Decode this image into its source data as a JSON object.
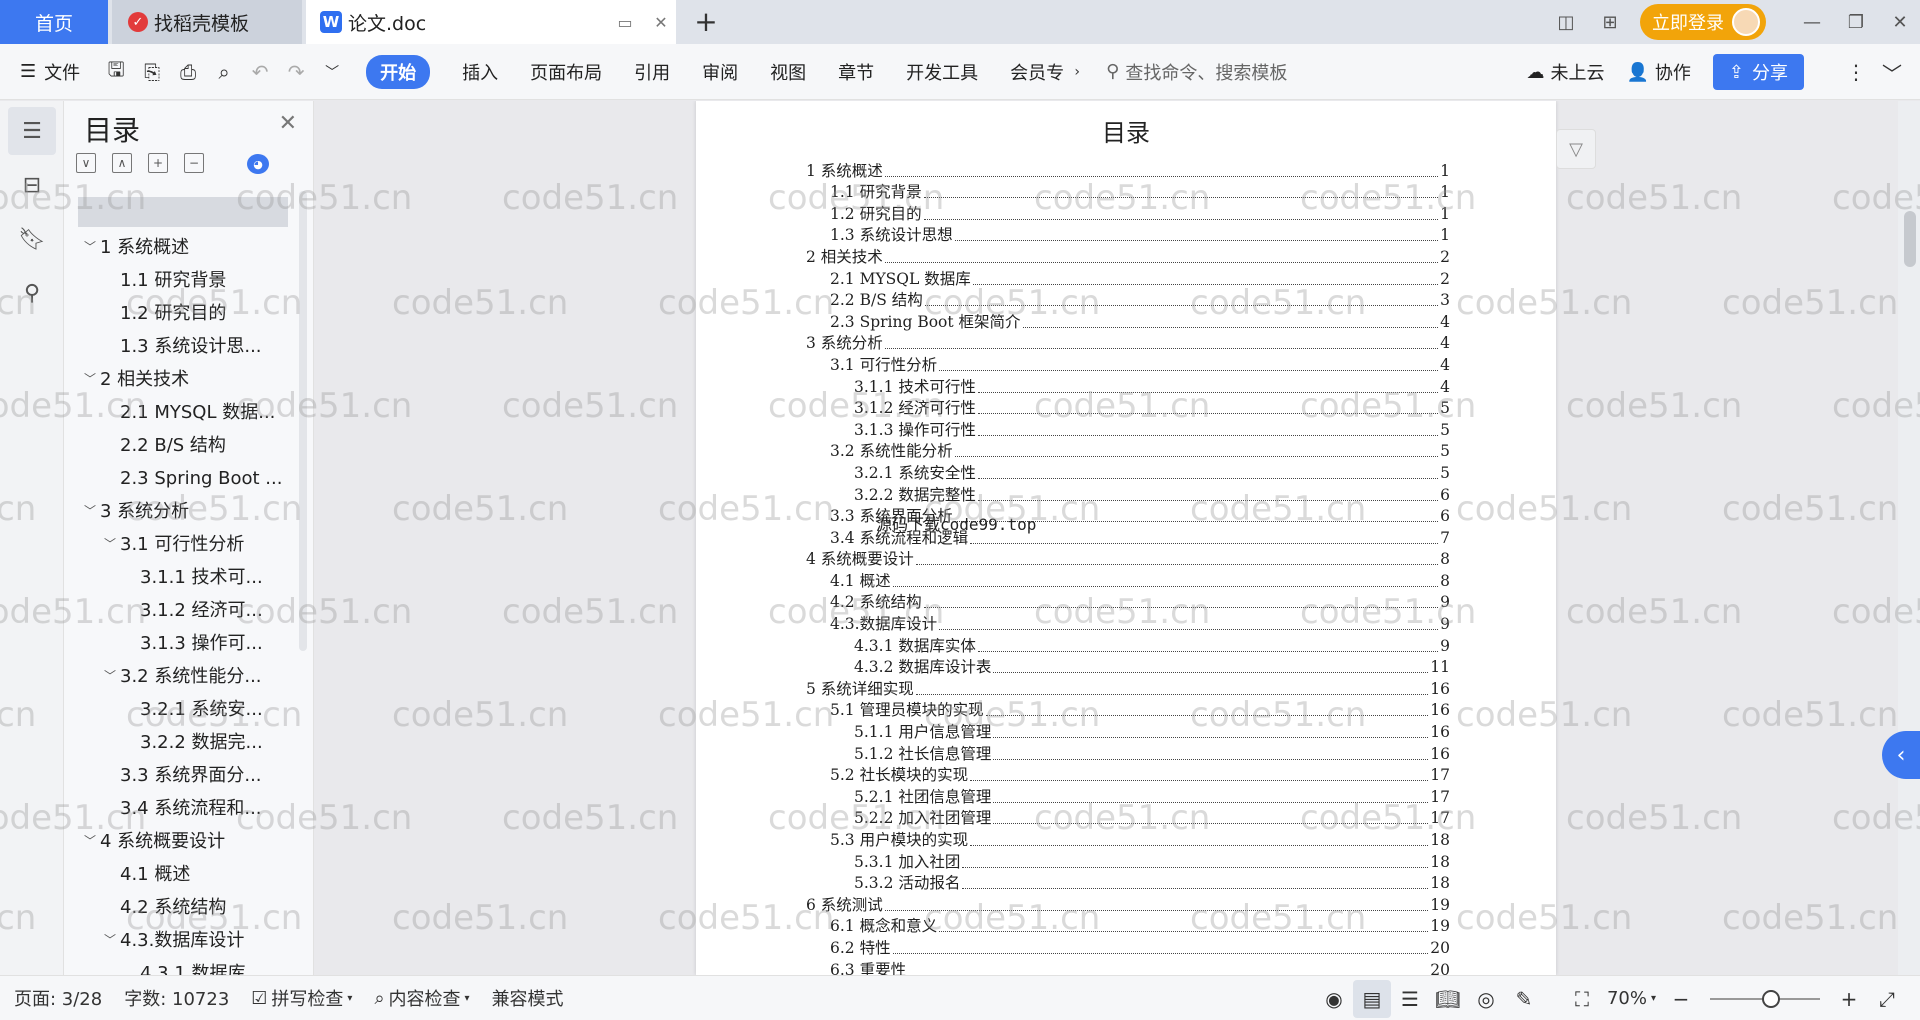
{
  "titlebar": {
    "tab_home": "首页",
    "tab_daoke": "找稻壳模板",
    "tab_doc": "论文.doc",
    "login": "立即登录"
  },
  "toolbar": {
    "file": "文件",
    "tabs": [
      "开始",
      "插入",
      "页面布局",
      "引用",
      "审阅",
      "视图",
      "章节",
      "开发工具",
      "会员专"
    ],
    "search_placeholder": "查找命令、搜索模板",
    "cloud": "未上云",
    "collab": "协作",
    "share": "分享"
  },
  "toc_panel": {
    "title": "目录",
    "items": [
      {
        "label": "1 系统概述",
        "level": 0,
        "caret": "﹀"
      },
      {
        "label": "1.1  研究背景",
        "level": 1,
        "caret": ""
      },
      {
        "label": "1.2 研究目的",
        "level": 1,
        "caret": ""
      },
      {
        "label": "1.3 系统设计思...",
        "level": 1,
        "caret": ""
      },
      {
        "label": "2 相关技术",
        "level": 0,
        "caret": "﹀"
      },
      {
        "label": "2.1 MYSQL 数据...",
        "level": 1,
        "caret": ""
      },
      {
        "label": "2.2 B/S 结构",
        "level": 1,
        "caret": ""
      },
      {
        "label": "2.3 Spring Boot ...",
        "level": 1,
        "caret": ""
      },
      {
        "label": "3 系统分析",
        "level": 0,
        "caret": "﹀"
      },
      {
        "label": "3.1 可行性分析",
        "level": 1,
        "caret": "﹀"
      },
      {
        "label": "3.1.1 技术可...",
        "level": 2,
        "caret": ""
      },
      {
        "label": "3.1.2 经济可...",
        "level": 2,
        "caret": ""
      },
      {
        "label": "3.1.3 操作可...",
        "level": 2,
        "caret": ""
      },
      {
        "label": "3.2 系统性能分...",
        "level": 1,
        "caret": "﹀"
      },
      {
        "label": "3.2.1  系统安...",
        "level": 2,
        "caret": ""
      },
      {
        "label": "3.2.2  数据完...",
        "level": 2,
        "caret": ""
      },
      {
        "label": "3.3 系统界面分...",
        "level": 1,
        "caret": ""
      },
      {
        "label": "3.4 系统流程和...",
        "level": 1,
        "caret": ""
      },
      {
        "label": "4 系统概要设计",
        "level": 0,
        "caret": "﹀"
      },
      {
        "label": "4.1 概述",
        "level": 1,
        "caret": ""
      },
      {
        "label": "4.2 系统结构",
        "level": 1,
        "caret": ""
      },
      {
        "label": "4.3.数据库设计",
        "level": 1,
        "caret": "﹀"
      },
      {
        "label": "4.3.1 数据库...",
        "level": 2,
        "caret": ""
      }
    ]
  },
  "document": {
    "heading": "目录",
    "watermark_text": "源码下载code99.top",
    "lines": [
      {
        "text": "1 系统概述",
        "page": "1",
        "level": 0
      },
      {
        "text": "1.1  研究背景",
        "page": "1",
        "level": 1
      },
      {
        "text": "1.2 研究目的",
        "page": "1",
        "level": 1
      },
      {
        "text": "1.3 系统设计思想",
        "page": "1",
        "level": 1
      },
      {
        "text": "2 相关技术",
        "page": "2",
        "level": 0
      },
      {
        "text": "2.1 MYSQL 数据库",
        "page": "2",
        "level": 1
      },
      {
        "text": "2.2 B/S 结构",
        "page": "3",
        "level": 1
      },
      {
        "text": "2.3 Spring Boot 框架简介",
        "page": "4",
        "level": 1
      },
      {
        "text": "3 系统分析",
        "page": "4",
        "level": 0
      },
      {
        "text": "3.1 可行性分析",
        "page": "4",
        "level": 1
      },
      {
        "text": "3.1.1 技术可行性",
        "page": "4",
        "level": 2
      },
      {
        "text": "3.1.2 经济可行性",
        "page": "5",
        "level": 2
      },
      {
        "text": "3.1.3 操作可行性",
        "page": "5",
        "level": 2
      },
      {
        "text": "3.2 系统性能分析",
        "page": "5",
        "level": 1
      },
      {
        "text": "3.2.1  系统安全性",
        "page": "5",
        "level": 2
      },
      {
        "text": "3.2.2  数据完整性",
        "page": "6",
        "level": 2
      },
      {
        "text": "3.3 系统界面分析",
        "page": "6",
        "level": 1
      },
      {
        "text": "3.4 系统流程和逻辑",
        "page": "7",
        "level": 1
      },
      {
        "text": "4 系统概要设计",
        "page": "8",
        "level": 0
      },
      {
        "text": "4.1 概述",
        "page": "8",
        "level": 1
      },
      {
        "text": "4.2 系统结构",
        "page": "9",
        "level": 1
      },
      {
        "text": "4.3.数据库设计",
        "page": "9",
        "level": 1
      },
      {
        "text": "4.3.1 数据库实体",
        "page": "9",
        "level": 2
      },
      {
        "text": "4.3.2 数据库设计表",
        "page": "11",
        "level": 2
      },
      {
        "text": "5 系统详细实现",
        "page": "16",
        "level": 0
      },
      {
        "text": "5.1  管理员模块的实现",
        "page": "16",
        "level": 1
      },
      {
        "text": "5.1.1  用户信息管理",
        "page": "16",
        "level": 2
      },
      {
        "text": "5.1.2  社长信息管理",
        "page": "16",
        "level": 2
      },
      {
        "text": "5.2  社长模块的实现",
        "page": "17",
        "level": 1
      },
      {
        "text": "5.2.1  社团信息管理",
        "page": "17",
        "level": 2
      },
      {
        "text": "5.2.2  加入社团管理",
        "page": "17",
        "level": 2
      },
      {
        "text": "5.3  用户模块的实现",
        "page": "18",
        "level": 1
      },
      {
        "text": "5.3.1  加入社团",
        "page": "18",
        "level": 2
      },
      {
        "text": "5.3.2  活动报名",
        "page": "18",
        "level": 2
      },
      {
        "text": "6 系统测试",
        "page": "19",
        "level": 0
      },
      {
        "text": "6.1 概念和意义",
        "page": "19",
        "level": 1
      },
      {
        "text": "6.2 特性",
        "page": "20",
        "level": 1
      },
      {
        "text": "6.3 重要性",
        "page": "20",
        "level": 1
      }
    ]
  },
  "statusbar": {
    "page": "页面: 3/28",
    "words": "字数: 10723",
    "spell": "拼写检查",
    "content": "内容检查",
    "compat": "兼容模式",
    "zoom": "70%",
    "zoom_fraction": 0.55
  },
  "watermark": "code51.cn",
  "colors": {
    "accent": "#3d78f0",
    "login": "#f2a40a"
  }
}
